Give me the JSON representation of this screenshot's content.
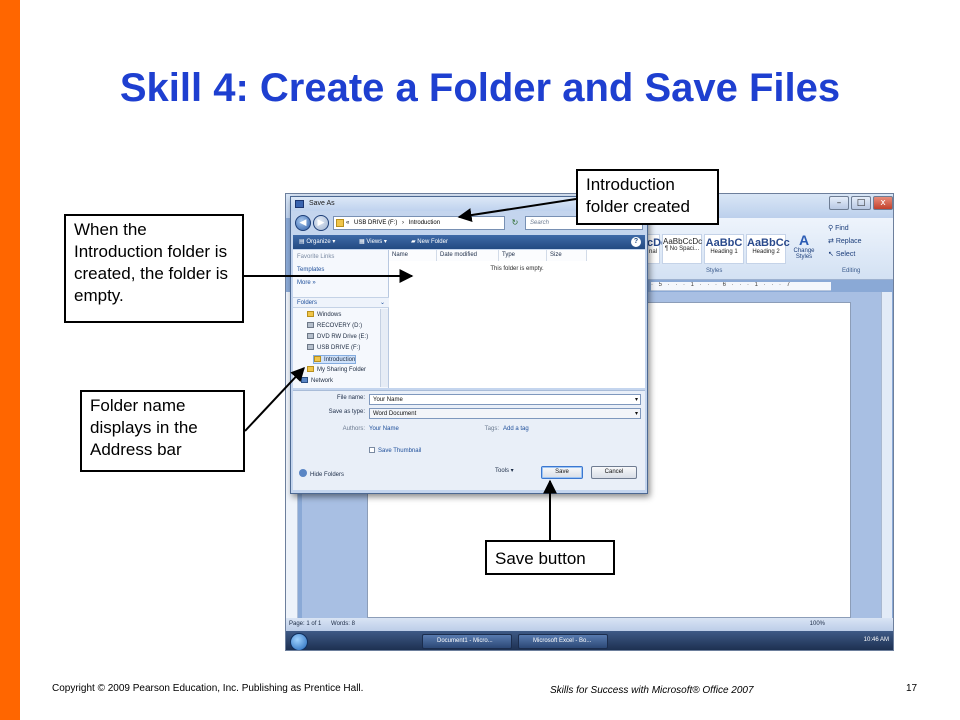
{
  "slide": {
    "title": "Skill 4: Create a Folder and Save Files",
    "accent_color": "#ff6600",
    "title_color": "#1e3fd0"
  },
  "callouts": {
    "introduction_created": "Introduction folder created",
    "folder_empty": "When the Introduction folder is created, the folder is empty.",
    "address_bar": "Folder name displays in the Address bar",
    "save_button": "Save button"
  },
  "word": {
    "window_controls": {
      "minimize": "–",
      "maximize": "□",
      "close": "x"
    },
    "ribbon": {
      "styles": [
        {
          "preview": "cDc",
          "name": "nal"
        },
        {
          "preview": "AaBbCcDc",
          "name": "¶ No Spaci..."
        },
        {
          "preview": "AaBbC",
          "name": "Heading 1"
        },
        {
          "preview": "AaBbCc",
          "name": "Heading 2"
        }
      ],
      "change_styles": "Change Styles",
      "styles_group": "Styles",
      "editing_group": "Editing",
      "find": "Find",
      "replace": "Replace",
      "select": "Select"
    },
    "ruler": "· 5 · · · 1 · · · 6 · · · 1 · · · 7",
    "status": {
      "page": "Page: 1 of 1",
      "words": "Words: 8",
      "zoom": "100%"
    },
    "taskbar": {
      "buttons": [
        "Document1 - Micro...",
        "Microsoft Excel - Bo..."
      ],
      "clock": "10:46 AM"
    }
  },
  "dialog": {
    "title": "Save As",
    "address": {
      "prefix": "«",
      "path": [
        "USB DRIVE (F:)",
        "Introduction"
      ],
      "separator": "›"
    },
    "search_placeholder": "Search",
    "toolbar": {
      "organize": "Organize",
      "views": "Views",
      "new_folder": "New Folder"
    },
    "favorite_links": {
      "header": "Favorite Links",
      "items": [
        "Templates"
      ],
      "more": "More"
    },
    "folders": {
      "header": "Folders",
      "items": [
        "Windows",
        "RECOVERY (D:)",
        "DVD RW Drive (E:)",
        "USB DRIVE (F:)",
        "Introduction",
        "My Sharing Folder",
        "Network"
      ]
    },
    "columns": [
      "Name",
      "Date modified",
      "Type",
      "Size"
    ],
    "empty_message": "This folder is empty.",
    "form": {
      "file_name_label": "File name:",
      "file_name_value": "Your Name",
      "save_type_label": "Save as type:",
      "save_type_value": "Word Document",
      "authors_label": "Authors:",
      "authors_value": "Your Name",
      "tags_label": "Tags:",
      "tags_value": "Add a tag",
      "thumbnail_label": "Save Thumbnail"
    },
    "hide_folders": "Hide Folders",
    "tools": "Tools",
    "save": "Save",
    "cancel": "Cancel"
  },
  "footer": {
    "copyright": "Copyright © 2009 Pearson Education, Inc. Publishing as Prentice Hall.",
    "book": "Skills for Success with Microsoft® Office 2007",
    "page_number": "17"
  }
}
